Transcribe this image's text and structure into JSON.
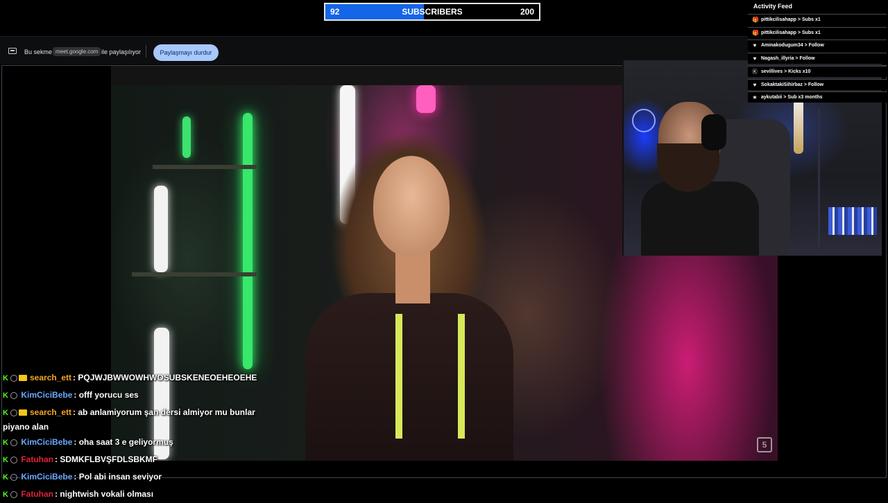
{
  "subscriber_goal": {
    "current": "92",
    "label": "SUBSCRIBERS",
    "goal": "200",
    "progress_fraction": 0.46,
    "fill_color": "#1565e8"
  },
  "share_bar": {
    "prefix": "Bu sekme",
    "domain": "meet.google.com",
    "suffix": "ile paylaşılıyor",
    "stop_button": "Paylaşmayı durdur"
  },
  "activity_feed": {
    "title": "Activity Feed",
    "items": [
      {
        "icon": "gift-icon",
        "name": "pittikcilisahapp",
        "action": " > Subs x1"
      },
      {
        "icon": "gift-icon",
        "name": "pittikcilisahapp",
        "action": " > Subs x1"
      },
      {
        "icon": "heart-icon",
        "name": "Aminakodugum34",
        "action": " > Follow"
      },
      {
        "icon": "heart-icon",
        "name": "Nagash_illyria",
        "action": " > Follow"
      },
      {
        "icon": "kick-icon",
        "name": "sevillives",
        "action": " > Kicks x10"
      },
      {
        "icon": "heart-icon",
        "name": "SokaktakiSihirbaz",
        "action": " > Follow"
      },
      {
        "icon": "star-icon",
        "name": "aykutabii",
        "action": " > Sub x3 months"
      }
    ]
  },
  "video": {
    "watermark": "5"
  },
  "chat": [
    {
      "user": "search_ett",
      "color": "#f5a623",
      "crown": true,
      "message": ": PQJWJBWWOWHWOSUBSKENEOEHEOEHE"
    },
    {
      "user": "KimCiciBebe",
      "color": "#6aa8ff",
      "crown": false,
      "message": ": offf yorucu ses"
    },
    {
      "user": "search_ett",
      "color": "#f5a623",
      "crown": true,
      "message": ": ab anlamiyorum şan dersi almiyor mu bunlar piyano alan"
    },
    {
      "user": "KimCiciBebe",
      "color": "#6aa8ff",
      "crown": false,
      "message": ": oha saat 3 e geliyormuş"
    },
    {
      "user": "Fatuhan",
      "color": "#e0203a",
      "crown": false,
      "message": ": SDMKFLBVŞFDLSBKMF"
    },
    {
      "user": "KimCiciBebe",
      "color": "#6aa8ff",
      "crown": false,
      "message": ": Pol abi insan seviyor"
    },
    {
      "user": "Fatuhan",
      "color": "#e0203a",
      "crown": false,
      "message": ": nightwish vokali olması"
    }
  ]
}
